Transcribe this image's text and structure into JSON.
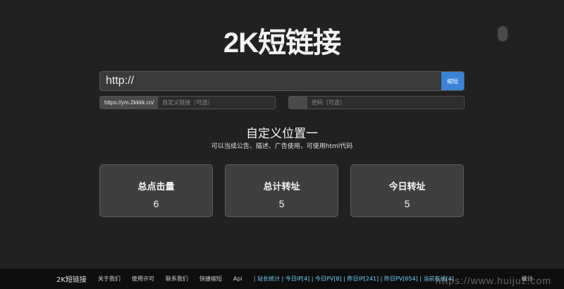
{
  "header": {
    "title": "2K短链接"
  },
  "shorten": {
    "url_value": "http://",
    "button_label": "缩短"
  },
  "custom": {
    "prefix": "https://ym.2kkkk.cn/",
    "placeholder": "自定义链接（可选）"
  },
  "password": {
    "placeholder": "密码（可选）"
  },
  "notice": {
    "heading": "自定义位置一",
    "description": "可以当成公告、描述、广告使用，可使用html代码"
  },
  "stats_cards": [
    {
      "label": "总点击量",
      "value": "6"
    },
    {
      "label": "总计转址",
      "value": "5"
    },
    {
      "label": "今日转址",
      "value": "5"
    }
  ],
  "footer": {
    "brand": "2K短链接",
    "links": [
      "关于我们",
      "使用许可",
      "联系我们",
      "快捷缩短",
      "Api"
    ],
    "stats_text": "| 站长统计 | 今日IP[4] | 今日PV[8] | 昨日IP[241] | 昨日PV[654] | 当前在线[4]",
    "stats_label": "统计"
  },
  "watermark": "https://www.huijuz.com"
}
